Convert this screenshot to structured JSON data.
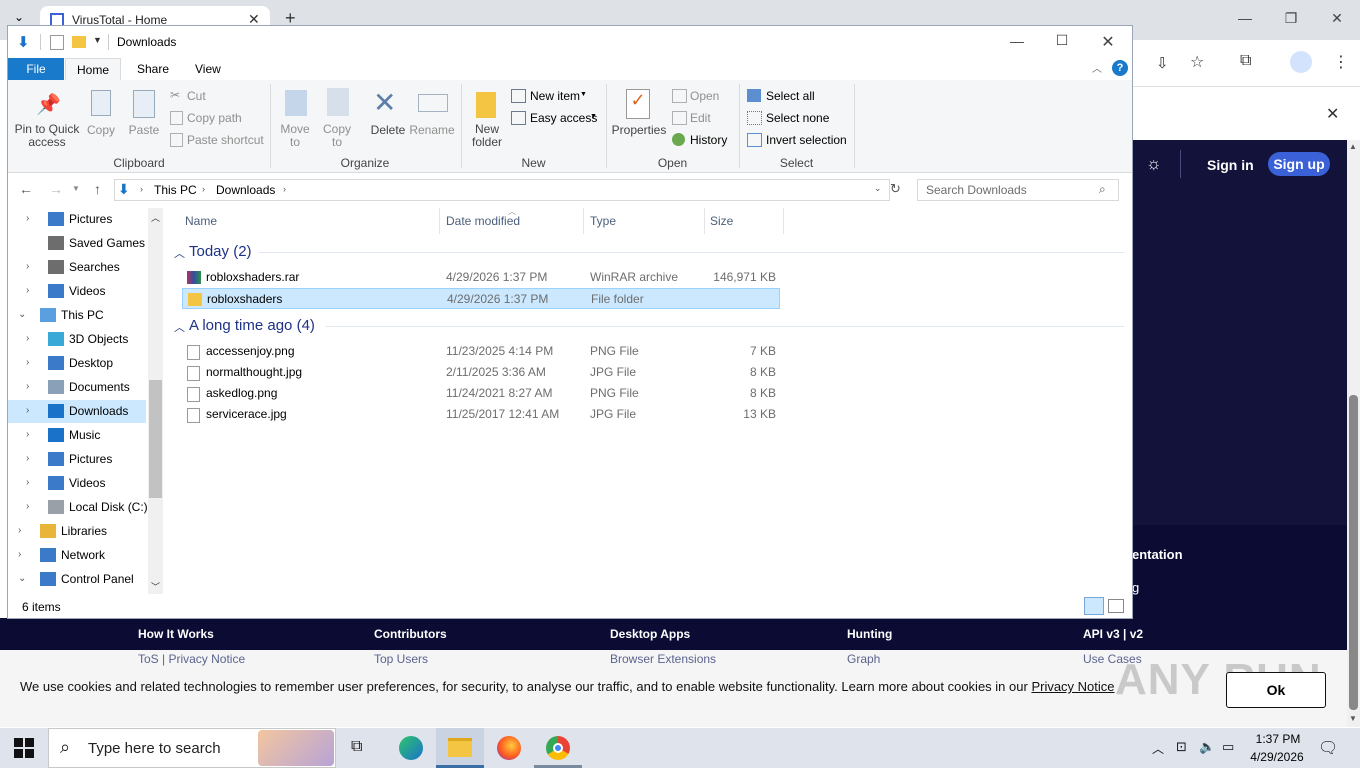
{
  "browser": {
    "tab_title": "VirusTotal - Home",
    "sign_in": "Sign in",
    "sign_up": "Sign up"
  },
  "virustotal": {
    "side_text_1": "entation",
    "side_text_2": "g",
    "footer": {
      "col1": "How It Works",
      "col2": "Contributors",
      "col3": "Desktop Apps",
      "col4": "Hunting",
      "col5": "API v3 | v2",
      "sub1": "ToS | Privacy Notice",
      "sub2": "Top Users",
      "sub3": "Browser Extensions",
      "sub4": "Graph",
      "sub5": "Use Cases"
    },
    "cookie_text": "We use cookies and related technologies to remember user preferences, for security, to analyse our traffic, and to enable website functionality. Learn more about cookies in our",
    "cookie_link": "Privacy Notice",
    "cookie_ok": "Ok"
  },
  "explorer": {
    "title": "Downloads",
    "ribbon_tabs": [
      "File",
      "Home",
      "Share",
      "View"
    ],
    "clipboard": {
      "pin_line1": "Pin to Quick",
      "pin_line2": "access",
      "copy": "Copy",
      "paste": "Paste",
      "cut": "Cut",
      "copy_path": "Copy path",
      "paste_shortcut": "Paste shortcut",
      "label": "Clipboard"
    },
    "organize": {
      "move_to": "Move",
      "move_to2": "to",
      "copy_to": "Copy",
      "copy_to2": "to",
      "delete": "Delete",
      "rename": "Rename",
      "label": "Organize"
    },
    "new_group": {
      "new_folder1": "New",
      "new_folder2": "folder",
      "new_item": "New item",
      "easy_access": "Easy access",
      "label": "New"
    },
    "open_group": {
      "properties": "Properties",
      "open": "Open",
      "edit": "Edit",
      "history": "History",
      "label": "Open"
    },
    "select_group": {
      "select_all": "Select all",
      "select_none": "Select none",
      "invert": "Invert selection",
      "label": "Select"
    },
    "address": {
      "part1": "This PC",
      "part2": "Downloads"
    },
    "search_placeholder": "Search Downloads",
    "nav": [
      {
        "label": "Pictures",
        "icon": "pictures-icon"
      },
      {
        "label": "Saved Games",
        "icon": "saved-games-icon"
      },
      {
        "label": "Searches",
        "icon": "searches-icon"
      },
      {
        "label": "Videos",
        "icon": "videos-icon"
      },
      {
        "label": "This PC",
        "icon": "this-pc-icon"
      },
      {
        "label": "3D Objects",
        "icon": "3d-objects-icon"
      },
      {
        "label": "Desktop",
        "icon": "desktop-icon"
      },
      {
        "label": "Documents",
        "icon": "documents-icon"
      },
      {
        "label": "Downloads",
        "icon": "downloads-icon"
      },
      {
        "label": "Music",
        "icon": "music-icon"
      },
      {
        "label": "Pictures",
        "icon": "pictures-icon"
      },
      {
        "label": "Videos",
        "icon": "videos-icon"
      },
      {
        "label": "Local Disk (C:)",
        "icon": "local-disk-icon"
      },
      {
        "label": "Libraries",
        "icon": "libraries-icon"
      },
      {
        "label": "Network",
        "icon": "network-icon"
      },
      {
        "label": "Control Panel",
        "icon": "control-panel-icon"
      }
    ],
    "columns": {
      "name": "Name",
      "date": "Date modified",
      "type": "Type",
      "size": "Size"
    },
    "group_today": "Today (2)",
    "group_long_ago": "A long time ago (4)",
    "files_today": [
      {
        "name": "robloxshaders.rar",
        "date": "4/29/2026 1:37 PM",
        "type": "WinRAR archive",
        "size": "146,971 KB",
        "icon": "winrar-icon"
      },
      {
        "name": "robloxshaders",
        "date": "4/29/2026 1:37 PM",
        "type": "File folder",
        "size": "",
        "icon": "folder-icon"
      }
    ],
    "files_old": [
      {
        "name": "accessenjoy.png",
        "date": "11/23/2025 4:14 PM",
        "type": "PNG File",
        "size": "7 KB",
        "icon": "image-file-icon"
      },
      {
        "name": "normalthought.jpg",
        "date": "2/11/2025 3:36 AM",
        "type": "JPG File",
        "size": "8 KB",
        "icon": "image-file-icon"
      },
      {
        "name": "askedlog.png",
        "date": "11/24/2021 8:27 AM",
        "type": "PNG File",
        "size": "8 KB",
        "icon": "image-file-icon"
      },
      {
        "name": "servicerace.jpg",
        "date": "11/25/2017 12:41 AM",
        "type": "JPG File",
        "size": "13 KB",
        "icon": "image-file-icon"
      }
    ],
    "status": "6 items"
  },
  "taskbar": {
    "search_placeholder": "Type here to search",
    "time": "1:37 PM",
    "date": "4/29/2026"
  },
  "watermark": "ANY RUN"
}
